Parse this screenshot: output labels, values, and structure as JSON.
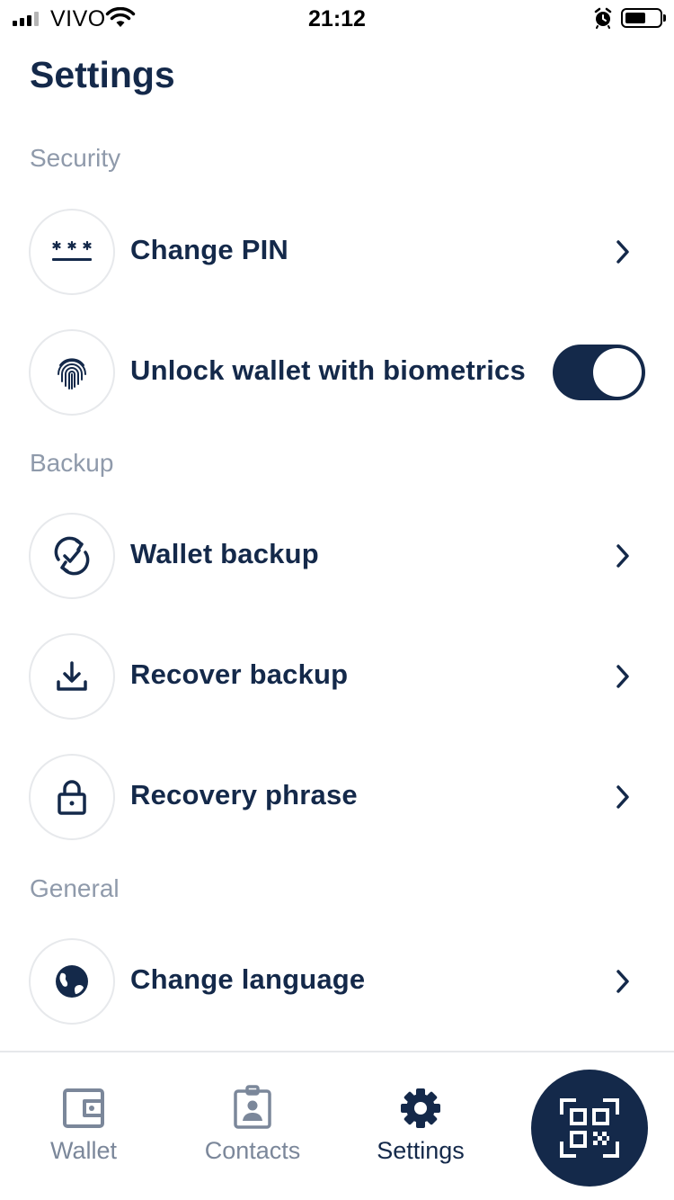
{
  "status_bar": {
    "carrier": "VIVO",
    "time": "21:12"
  },
  "page": {
    "title": "Settings"
  },
  "sections": {
    "security": {
      "header": "Security",
      "items": [
        {
          "label": "Change PIN",
          "icon": "pin-dots-icon",
          "control": "chevron"
        },
        {
          "label": "Unlock wallet with biometrics",
          "icon": "fingerprint-icon",
          "control": "toggle",
          "toggle_on": true
        }
      ]
    },
    "backup": {
      "header": "Backup",
      "items": [
        {
          "label": "Wallet backup",
          "icon": "sync-check-icon",
          "control": "chevron"
        },
        {
          "label": "Recover backup",
          "icon": "download-icon",
          "control": "chevron"
        },
        {
          "label": "Recovery phrase",
          "icon": "lock-icon",
          "control": "chevron"
        }
      ]
    },
    "general": {
      "header": "General",
      "items": [
        {
          "label": "Change language",
          "icon": "globe-icon",
          "control": "chevron"
        }
      ]
    }
  },
  "bottom_nav": {
    "items": [
      {
        "label": "Wallet",
        "icon": "wallet-icon",
        "active": false
      },
      {
        "label": "Contacts",
        "icon": "contact-badge-icon",
        "active": false
      },
      {
        "label": "Settings",
        "icon": "gear-icon",
        "active": true
      }
    ],
    "scan_icon": "qr-code-icon"
  },
  "colors": {
    "primary": "#14294a",
    "muted": "#8f9aab",
    "nav_inactive": "#7b879a",
    "divider": "#e6e8eb",
    "background": "#ffffff"
  }
}
